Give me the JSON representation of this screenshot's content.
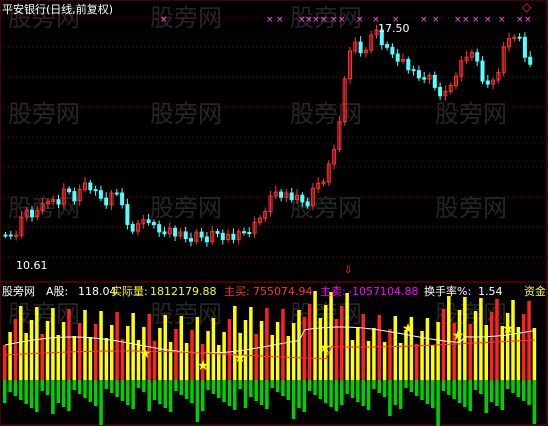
{
  "header": {
    "title": "平安银行(日线,前复权)",
    "title_color": "#ffffff"
  },
  "watermark": "股旁网",
  "price_panel": {
    "high_marker": "17.50",
    "low_marker": "10.61",
    "price_line_color": "#ffffff",
    "grid_color": "#8b0000"
  },
  "indicator_bar": {
    "name": "股旁网",
    "a_label": "A股:",
    "a_value": "118.04",
    "actual_volume_label": "实际量:",
    "actual_volume_value": "1812179.88",
    "main_buy_label": "主买:",
    "main_buy_value": "755074.94",
    "main_sell_label": "主卖:",
    "main_sell_value": "-1057104.88",
    "turnover_label": "换手率%:",
    "turnover_value": "1.54",
    "funds_label": "资金"
  },
  "colors": {
    "up_candle": "#ff3232",
    "down_candle": "#54ffff",
    "label_white": "#ffffff",
    "label_yellow": "#ffff00",
    "label_red": "#ff3232",
    "label_magenta": "#ff00ff",
    "marker_magenta": "#ff55ff",
    "vol_yellow": "#ffff00",
    "vol_red": "#ff2020",
    "vol_green": "#00d000",
    "star": "#ffff00"
  },
  "icons": {
    "diamond": "diamond-icon",
    "arrow": "down-arrow-icon"
  }
}
